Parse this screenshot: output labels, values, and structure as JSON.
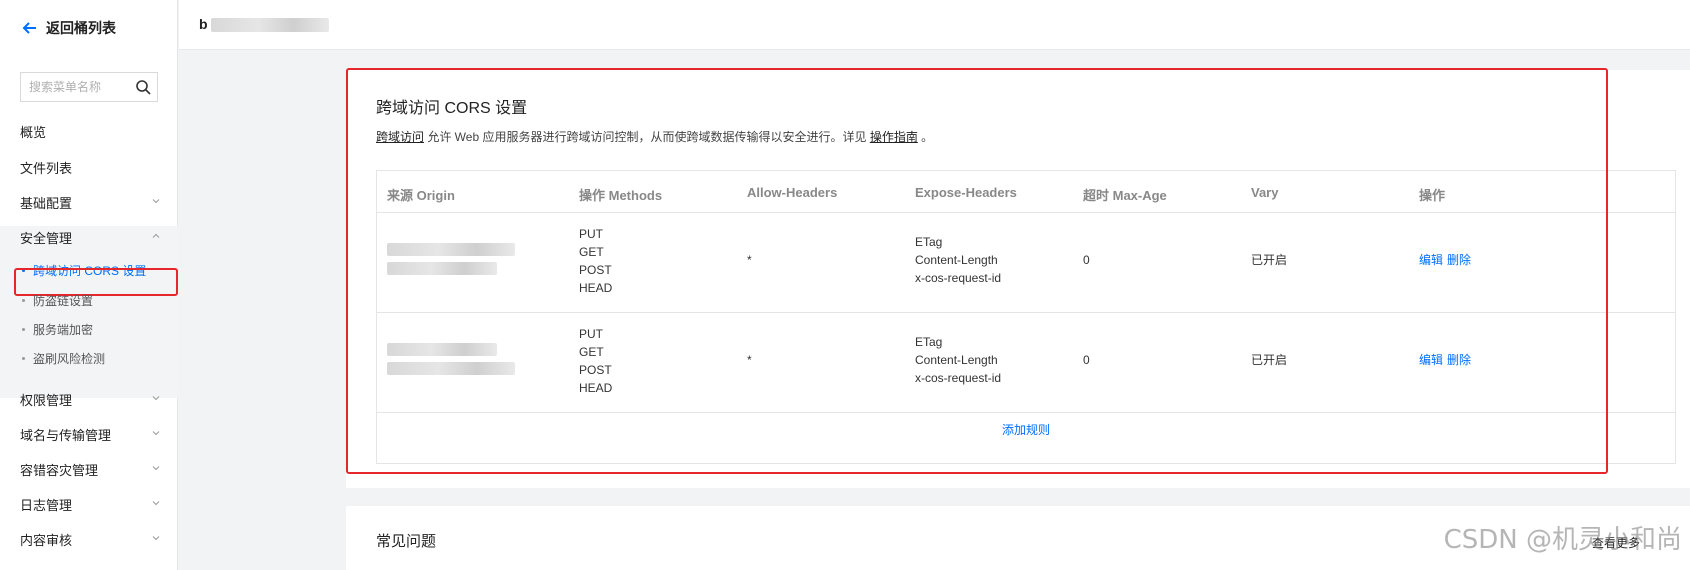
{
  "sidebar": {
    "back_label": "返回桶列表",
    "search_placeholder": "搜索菜单名称",
    "items": {
      "overview": "概览",
      "files": "文件列表",
      "basic": "基础配置",
      "security": "安全管理",
      "permissions": "权限管理",
      "domains": "域名与传输管理",
      "disaster": "容错容灾管理",
      "logs": "日志管理",
      "content": "内容审核"
    },
    "security_sub": {
      "cors": "跨域访问 CORS 设置",
      "hotlink": "防盗链设置",
      "encryption": "服务端加密",
      "risk": "盗刷风险检测"
    }
  },
  "header": {
    "bucket_prefix": "b"
  },
  "cors": {
    "title": "跨域访问 CORS 设置",
    "desc_link1": "跨域访问",
    "desc_text": " 允许 Web 应用服务器进行跨域访问控制，从而使跨域数据传输得以安全进行。详见 ",
    "desc_link2": "操作指南",
    "desc_end": " 。",
    "columns": [
      "来源 Origin",
      "操作 Methods",
      "Allow-Headers",
      "Expose-Headers",
      "超时 Max-Age",
      "Vary",
      "操作"
    ],
    "rows": [
      {
        "methods": [
          "PUT",
          "GET",
          "POST",
          "HEAD"
        ],
        "allow_headers": "*",
        "expose_headers": [
          "ETag",
          "Content-Length",
          "x-cos-request-id"
        ],
        "max_age": "0",
        "vary": "已开启",
        "edit": "编辑",
        "delete": "删除"
      },
      {
        "methods": [
          "PUT",
          "GET",
          "POST",
          "HEAD"
        ],
        "allow_headers": "*",
        "expose_headers": [
          "ETag",
          "Content-Length",
          "x-cos-request-id"
        ],
        "max_age": "0",
        "vary": "已开启",
        "edit": "编辑",
        "delete": "删除"
      }
    ],
    "add_rule": "添加规则"
  },
  "faq": {
    "title": "常见问题",
    "more": "查看更多"
  },
  "watermark": "CSDN @机灵小和尚",
  "colors": {
    "accent": "#006eff",
    "highlight": "#e5262b"
  }
}
